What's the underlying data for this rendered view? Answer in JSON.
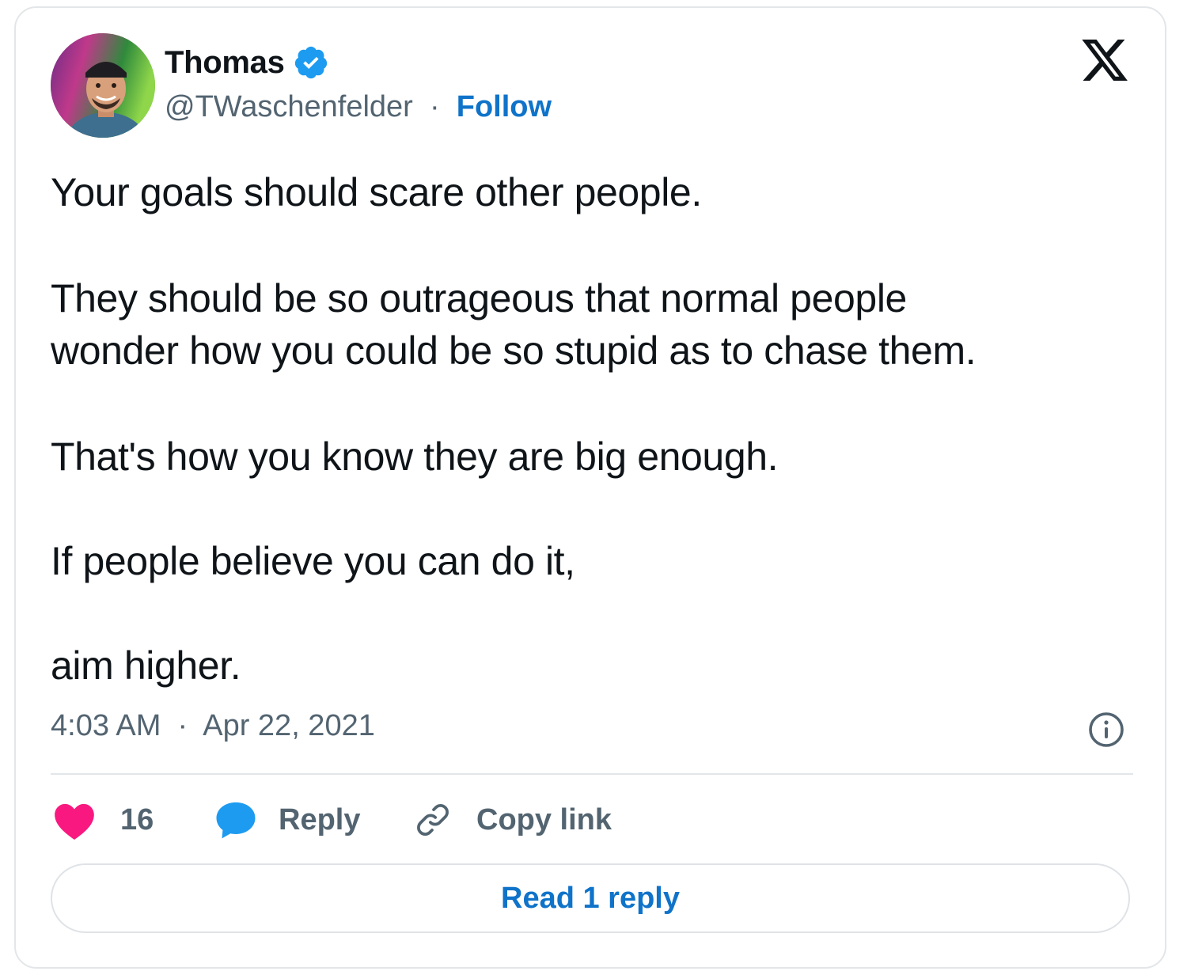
{
  "author": {
    "name": "Thomas",
    "handle": "@TWaschenfelder",
    "separator": "·",
    "follow_label": "Follow",
    "verified_icon": "verified-badge-icon",
    "accent_color": "#1d9bf0"
  },
  "tweet": {
    "paragraphs": [
      "Your goals should scare other people.",
      "They should be so outrageous that normal people",
      "wonder how you could be so stupid as to chase them.",
      "That's how you know they are big enough.",
      "If people believe you can do it,",
      "aim higher."
    ],
    "time": "4:03 AM",
    "separator": "·",
    "date": "Apr 22, 2021"
  },
  "actions": {
    "like_count": "16",
    "reply_label": "Reply",
    "copy_link_label": "Copy link",
    "like_color": "#f91880",
    "reply_color": "#1d9bf0"
  },
  "footer": {
    "read_replies_label": "Read 1 reply"
  }
}
